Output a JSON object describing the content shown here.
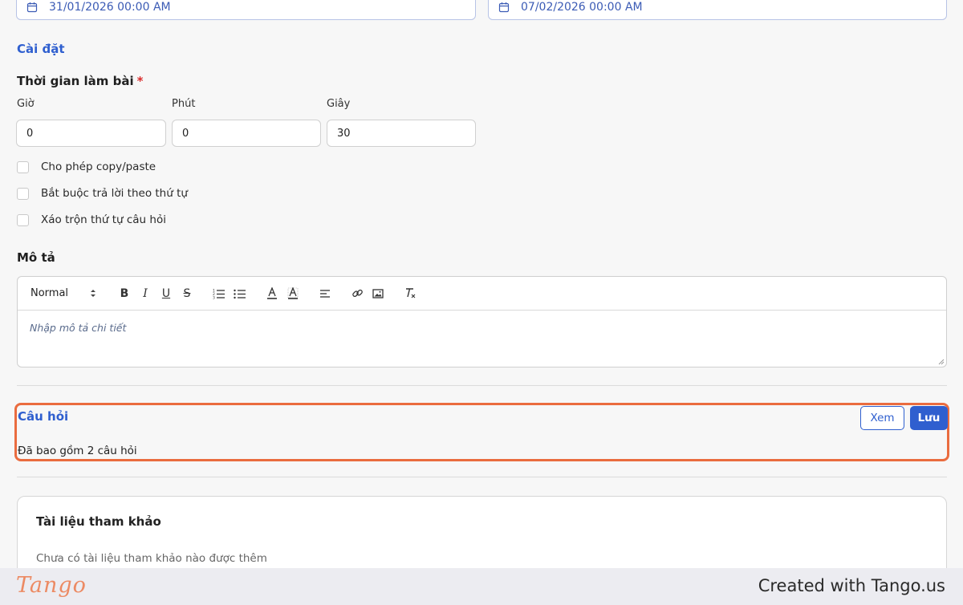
{
  "dates": {
    "start_value": "31/01/2026 00:00 AM",
    "end_value": "07/02/2026 00:00 AM",
    "icon": "calendar-icon"
  },
  "settings": {
    "title": "Cài đặt",
    "duration_label": "Thời gian làm bài",
    "required_mark": "*",
    "hours_label": "Giờ",
    "minutes_label": "Phút",
    "seconds_label": "Giây",
    "hours_value": "0",
    "minutes_value": "0",
    "seconds_value": "30",
    "options": [
      {
        "label": "Cho phép copy/paste",
        "checked": false
      },
      {
        "label": "Bắt buộc trả lời theo thứ tự",
        "checked": false
      },
      {
        "label": "Xáo trộn thứ tự câu hỏi",
        "checked": false
      }
    ]
  },
  "description": {
    "label": "Mô tả",
    "format_value": "Normal",
    "placeholder": "Nhập mô tả chi tiết",
    "toolbar_icons": [
      "bold-icon",
      "italic-icon",
      "underline-icon",
      "strike-icon",
      "ordered-list-icon",
      "bullet-list-icon",
      "text-color-icon",
      "background-color-icon",
      "align-icon",
      "link-icon",
      "image-icon",
      "clear-format-icon"
    ]
  },
  "questions": {
    "title": "Câu hỏi",
    "summary": "Đã bao gồm 2 câu hỏi",
    "view_button": "Xem",
    "save_button": "Lưu",
    "highlight_color": "#ea6c3f"
  },
  "references": {
    "title": "Tài liệu tham khảo",
    "empty_text": "Chưa có tài liệu tham khảo nào được thêm"
  },
  "footer": {
    "logo": "Tango",
    "created_text": "Created with Tango.us"
  },
  "colors": {
    "accent": "#2f5fcf",
    "highlight": "#ea6c3f",
    "required": "#d92c2c"
  }
}
